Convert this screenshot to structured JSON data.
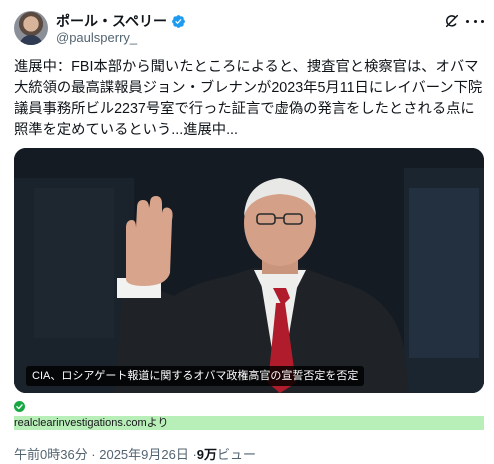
{
  "author": {
    "display_name": "ポール・スペリー",
    "handle": "@paulsperry_",
    "verified": true,
    "verified_color": "#1d9bf0"
  },
  "header_actions": {
    "grok_icon": "grok-icon",
    "more_icon": "more-horizontal-icon"
  },
  "tweet": {
    "text": "進展中：FBI本部から聞いたところによると、捜査官と検察官は、オバマ大統領の最高諜報員ジョン・ブレナンが2023年5月11日にレイバーン下院議員事務所ビル2237号室で行った証言で虚偽の発言をしたとされる点に照準を定めているという...進展中..."
  },
  "media": {
    "caption": "CIA、ロシアゲート報道に関するオバマ政権高官の宣誓否定を否定"
  },
  "source": {
    "check_icon_color": "#18a843",
    "link_text": "realclearinvestigations.comより",
    "highlight_color": "#b8eeb8"
  },
  "meta": {
    "timestamp": "午前0時36分 · 2025年9月26日 · ",
    "views_count": "9万",
    "views_label": " ビュー"
  }
}
